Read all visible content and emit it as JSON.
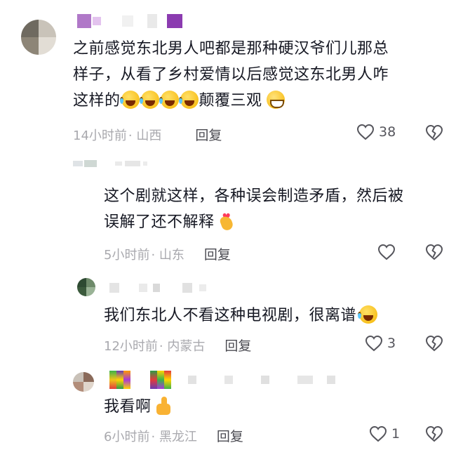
{
  "comments": [
    {
      "text_line1": "之前感觉东北男人吧都是那种硬汉爷们儿那总",
      "text_line2": "样子，从看了乡村爱情以后感觉这东北男人咋",
      "text_line3_a": "这样的",
      "text_line3_b": "颠覆三观",
      "emojis": [
        "laugh-cry-emoji",
        "laugh-cry-emoji",
        "laugh-cry-emoji",
        "laugh-cry-emoji",
        "grin-emoji"
      ],
      "time": "14小时前",
      "region": "· 山西",
      "reply": "回复",
      "likes": "38"
    },
    {
      "text_line1": "这个剧就这样，各种误会制造矛盾，然后被",
      "text_line2": "误解了还不解释",
      "emojis": [
        "heart-hand-emoji"
      ],
      "time": "5小时前",
      "region": "· 山东",
      "reply": "回复",
      "likes": ""
    },
    {
      "text_line1": "我们东北人不看这种电视剧，很离谱",
      "emojis": [
        "laugh-cry-emoji"
      ],
      "time": "12小时前",
      "region": "· 内蒙古",
      "reply": "回复",
      "likes": "3"
    },
    {
      "text_line1": "我看啊",
      "emojis": [
        "thumbs-up-emoji"
      ],
      "time": "6小时前",
      "region": "· 黑龙江",
      "reply": "回复",
      "likes": "1"
    }
  ],
  "colors": {
    "text": "#161823",
    "meta": "#a9a9ae",
    "reply": "#4b4b52",
    "icon": "#55555c"
  },
  "icons": {
    "like": "heart-outline-icon",
    "dislike": "broken-heart-icon"
  }
}
